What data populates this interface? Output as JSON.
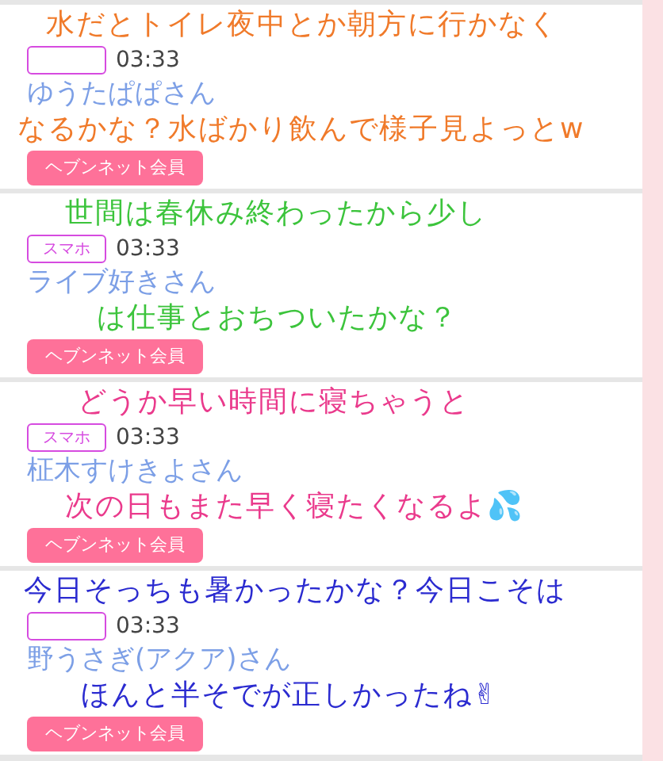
{
  "posts": [
    {
      "time": "03:33",
      "name": "ゆうたぱぱさん",
      "member_button": "ヘブンネット会員",
      "caption": {
        "kind": "orange",
        "lines": [
          "水だとトイレ夜中とか朝方に行かなく",
          "なるかな？水ばかり飲んで様子見よっとw"
        ]
      }
    },
    {
      "badge": "スマホ",
      "time": "03:33",
      "name": "ライブ好きさん",
      "member_button": "ヘブンネット会員",
      "caption": {
        "kind": "green",
        "lines": [
          "世間は春休み終わったから少し",
          "は仕事とおちついたかな？"
        ]
      }
    },
    {
      "badge": "スマホ",
      "time": "03:33",
      "name": "柾木すけきよさん",
      "member_button": "ヘブンネット会員",
      "caption": {
        "kind": "pink",
        "lines": [
          "どうか早い時間に寝ちゃうと",
          "次の日もまた早く寝たくなるよ💦"
        ]
      }
    },
    {
      "time": "03:33",
      "name": "野うさぎ(アクア)さん",
      "member_button": "ヘブンネット会員",
      "caption": {
        "kind": "blue",
        "lines": [
          "今日そっちも暑かったかな？今日こそは",
          "ほんと半そでが正しかったね✌"
        ]
      }
    }
  ]
}
